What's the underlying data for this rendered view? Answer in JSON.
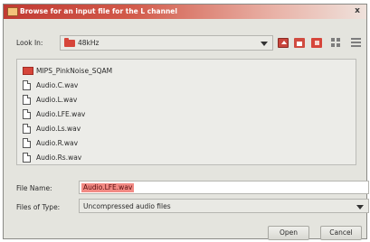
{
  "window": {
    "title": "Browse for an input file for the L channel",
    "close_glyph": "x"
  },
  "look_in": {
    "label": "Look In:",
    "value": "48kHz"
  },
  "toolbar": {
    "icons": [
      "up-folder-icon",
      "home-icon",
      "new-folder-icon",
      "list-view-icon",
      "details-view-icon"
    ]
  },
  "files": [
    {
      "name": "MIPS_PinkNoise_SQAM",
      "type": "folder"
    },
    {
      "name": "Audio.C.wav",
      "type": "file"
    },
    {
      "name": "Audio.L.wav",
      "type": "file"
    },
    {
      "name": "Audio.LFE.wav",
      "type": "file"
    },
    {
      "name": "Audio.Ls.wav",
      "type": "file"
    },
    {
      "name": "Audio.R.wav",
      "type": "file"
    },
    {
      "name": "Audio.Rs.wav",
      "type": "file"
    }
  ],
  "file_name": {
    "label": "File Name:",
    "value": "Audio.LFE.wav"
  },
  "files_of_type": {
    "label": "Files of Type:",
    "value": "Uncompressed audio files"
  },
  "buttons": {
    "open": "Open",
    "cancel": "Cancel"
  },
  "colors": {
    "accent": "#d6453a",
    "selection": "#f28a84"
  }
}
